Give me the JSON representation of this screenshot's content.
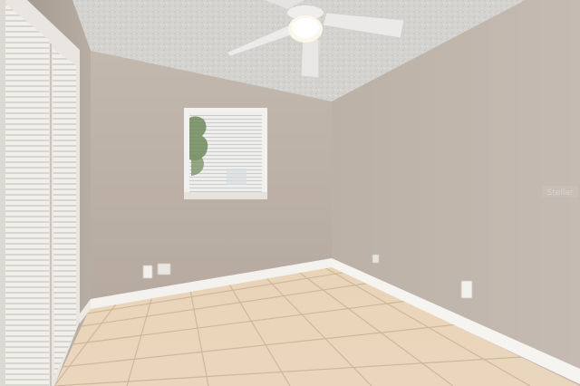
{
  "scene": {
    "description_type": "photo",
    "watermark": {
      "text": "Stellar"
    },
    "colors": {
      "wall_back": "#bdb1a6",
      "wall_right": "#c2b8ae",
      "wall_left": "#b1a79d",
      "ceiling": "#d6d4d1",
      "floor_tile": "#e8d2b4",
      "grout": "#cdb697",
      "baseboard": "#f4f2ee",
      "closet_door": "#f2f0ec",
      "window_frame": "#f3f1ee"
    }
  }
}
